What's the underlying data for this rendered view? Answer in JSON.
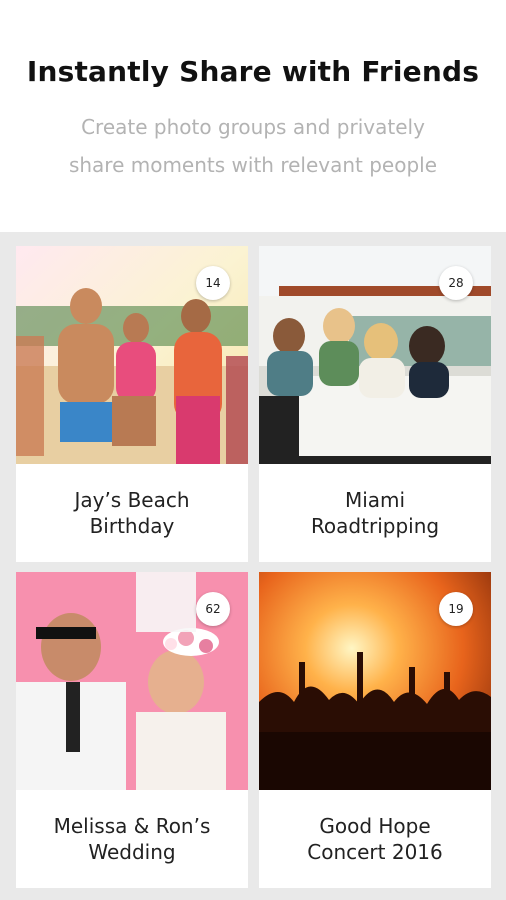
{
  "header": {
    "title": "Instantly Share with Friends",
    "subtitle_line1": "Create photo groups and privately",
    "subtitle_line2": "share moments with relevant people"
  },
  "groups": [
    {
      "name_line1": "Jay’s Beach",
      "name_line2": "Birthday",
      "count": "14"
    },
    {
      "name_line1": "Miami",
      "name_line2": "Roadtripping",
      "count": "28"
    },
    {
      "name_line1": "Melissa & Ron’s",
      "name_line2": "Wedding",
      "count": "62"
    },
    {
      "name_line1": "Good Hope",
      "name_line2": "Concert 2016",
      "count": "19"
    }
  ]
}
